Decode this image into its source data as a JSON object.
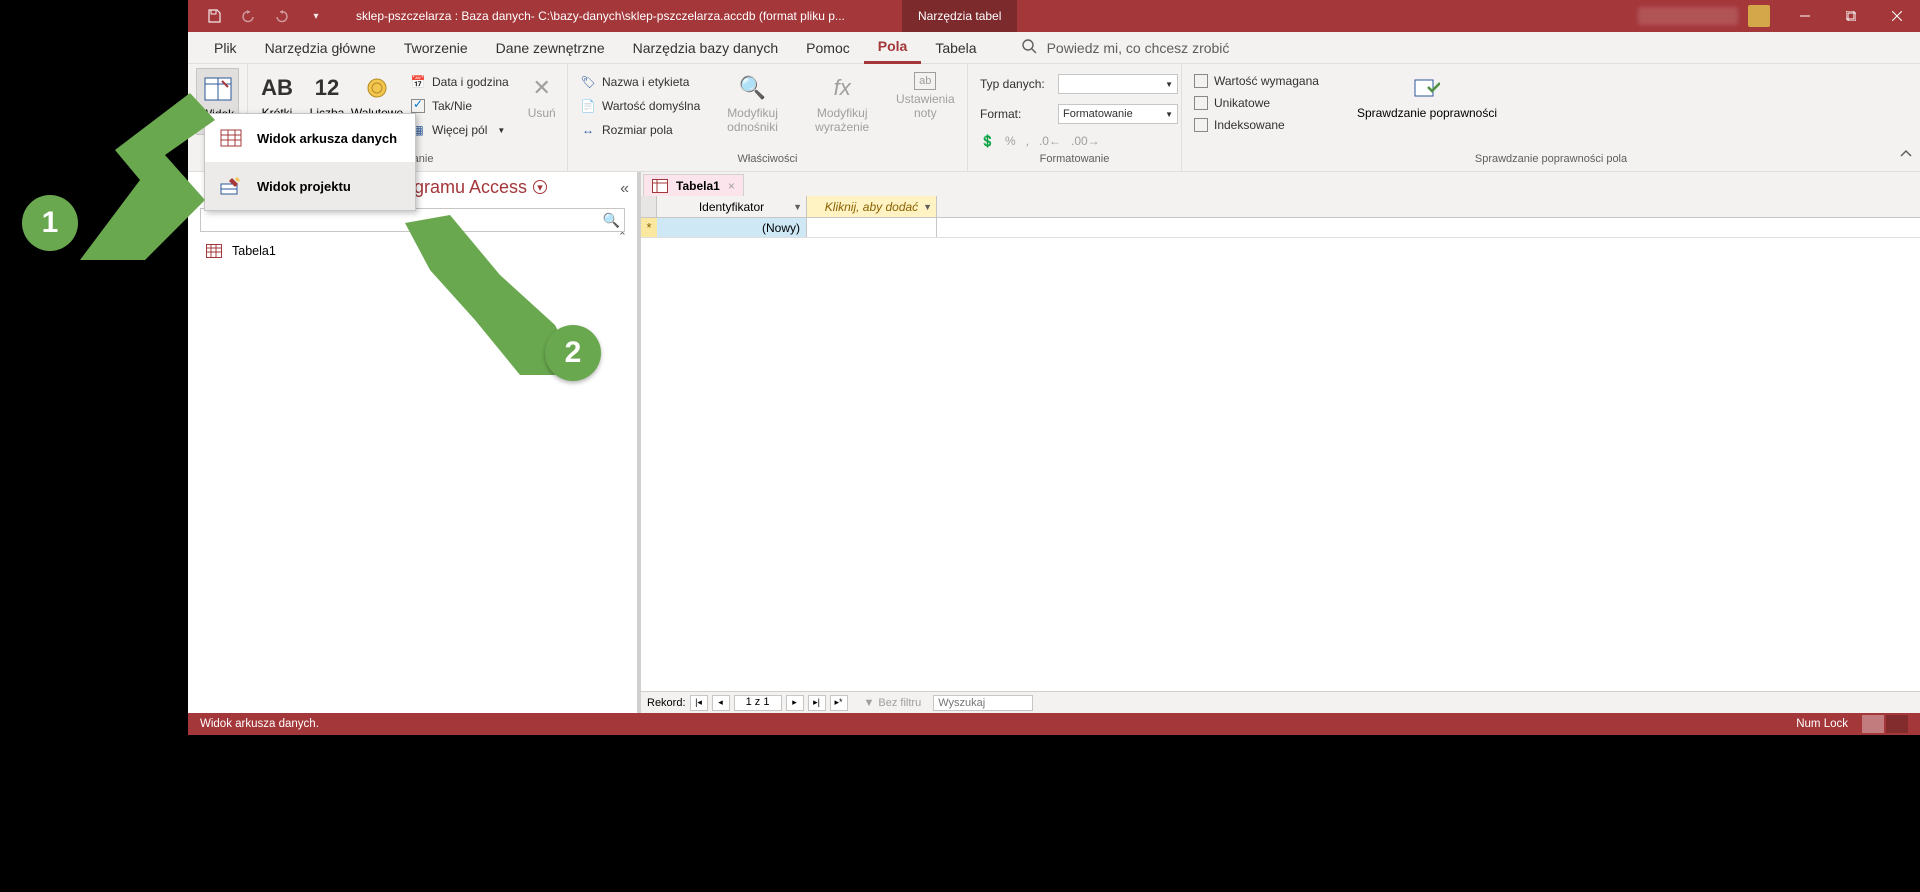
{
  "titlebar": {
    "title": "sklep-pszczelarza : Baza danych- C:\\bazy-danych\\sklep-pszczelarza.accdb (format pliku p...",
    "context_tab": "Narzędzia tabel"
  },
  "tabs": {
    "file": "Plik",
    "home": "Narzędzia główne",
    "create": "Tworzenie",
    "external": "Dane zewnętrzne",
    "dbtools": "Narzędzia bazy danych",
    "help": "Pomoc",
    "fields": "Pola",
    "table": "Tabela",
    "tellme": "Powiedz mi, co chcesz zrobić"
  },
  "ribbon": {
    "views": {
      "widok": "Widok"
    },
    "add_delete": {
      "short_text": "Krótki tekst",
      "number": "Liczba",
      "currency": "Walutowe",
      "date_time": "Data i godzina",
      "yes_no": "Tak/Nie",
      "more_fields": "Więcej pól",
      "delete": "Usuń",
      "group": "i usuwanie"
    },
    "properties": {
      "name_caption": "Nazwa i etykieta",
      "default_value": "Wartość domyślna",
      "field_size": "Rozmiar pola",
      "modify_lookups": "Modyfikuj odnośniki",
      "modify_expr": "Modyfikuj wyrażenie",
      "memo_settings": "Ustawienia noty",
      "group": "Właściwości"
    },
    "formatting": {
      "data_type": "Typ danych:",
      "format": "Format:",
      "format_val": "Formatowanie",
      "group": "Formatowanie"
    },
    "validation": {
      "required": "Wartość wymagana",
      "unique": "Unikatowe",
      "indexed": "Indeksowane",
      "validate": "Sprawdzanie poprawności",
      "group": "Sprawdzanie poprawności pola"
    }
  },
  "view_dropdown": {
    "datasheet": "Widok arkusza danych",
    "design": "Widok projektu"
  },
  "nav": {
    "header": "gramu Access",
    "tabela1": "Tabela1"
  },
  "doc": {
    "tab": "Tabela1",
    "col_id": "Identyfikator",
    "col_add": "Kliknij, aby dodać",
    "new_row": "(Nowy)"
  },
  "recnav": {
    "label": "Rekord:",
    "pos": "1 z 1",
    "no_filter": "Bez filtru",
    "search": "Wyszukaj"
  },
  "statusbar": {
    "left": "Widok arkusza danych.",
    "numlock": "Num Lock"
  }
}
